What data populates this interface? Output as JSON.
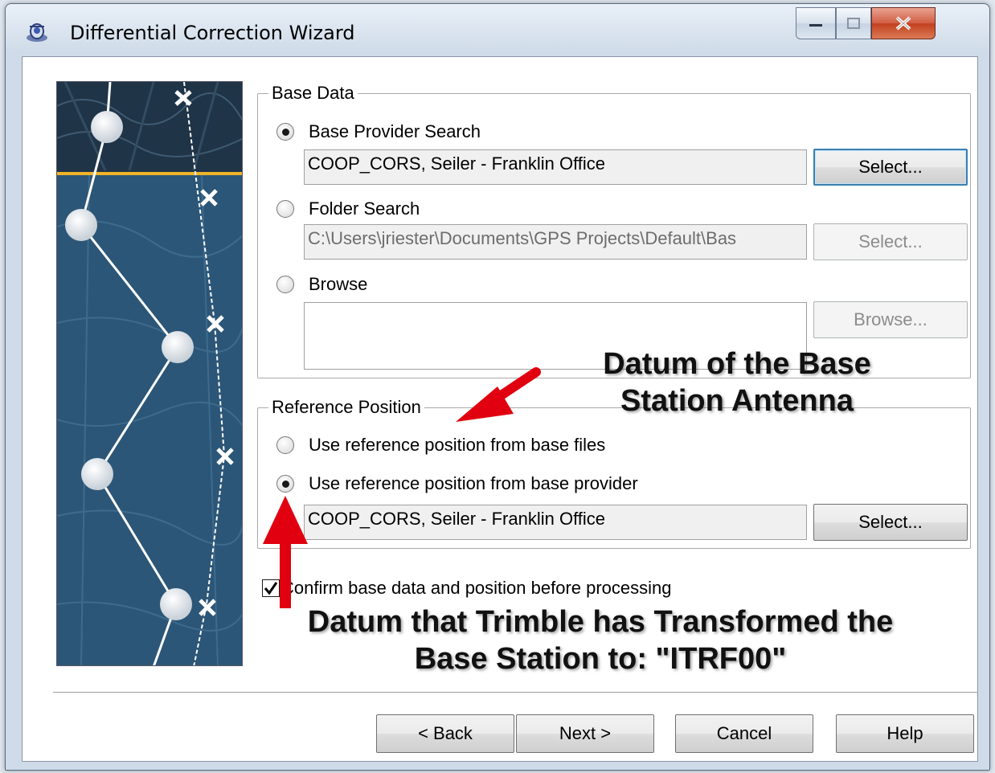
{
  "window": {
    "title": "Differential Correction Wizard",
    "controls": {
      "minimize": "minimize",
      "maximize": "maximize",
      "close": "close"
    }
  },
  "base_data": {
    "group_label": "Base Data",
    "options": [
      {
        "label": "Base Provider Search",
        "selected": true,
        "value": "COOP_CORS, Seiler - Franklin Office",
        "button": "Select...",
        "enabled": true
      },
      {
        "label": "Folder Search",
        "selected": false,
        "value": "C:\\Users\\jriester\\Documents\\GPS Projects\\Default\\Bas",
        "button": "Select...",
        "enabled": false
      },
      {
        "label": "Browse",
        "selected": false,
        "value": "",
        "button": "Browse...",
        "enabled": false
      }
    ]
  },
  "reference_position": {
    "group_label": "Reference Position",
    "options": [
      {
        "label": "Use reference position from base files",
        "selected": false
      },
      {
        "label": "Use reference position from base provider",
        "selected": true
      }
    ],
    "value": "COOP_CORS, Seiler - Franklin Office",
    "button": "Select..."
  },
  "confirm": {
    "label": "Confirm base data and position before processing",
    "checked": true
  },
  "annotations": {
    "top": [
      "Datum of the Base",
      "Station Antenna"
    ],
    "bottom": [
      "Datum that Trimble has Transformed the",
      "Base Station to:  \"ITRF00\""
    ]
  },
  "footer": {
    "back": "< Back",
    "next": "Next >",
    "cancel": "Cancel",
    "help": "Help"
  },
  "colors": {
    "arrow": "#e0000f",
    "sidebar_bg": "#294964",
    "sidebar_accent": "#f0b429"
  }
}
